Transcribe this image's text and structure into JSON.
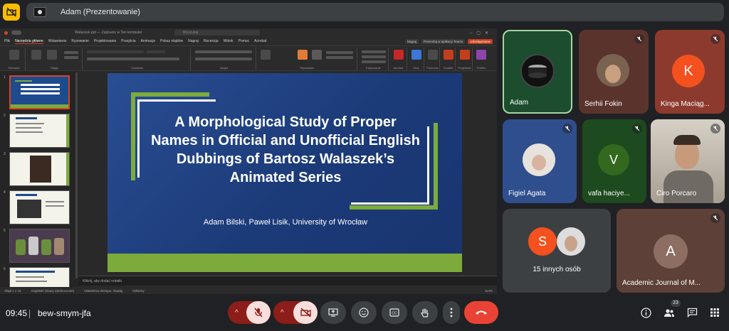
{
  "presenter_bar": {
    "title": "Adam (Prezentowanie)"
  },
  "powerpoint": {
    "doc_name": "Walaszek ppt — Zapisano w Ten komputer",
    "search_placeholder": "Wyszukaj",
    "menus": [
      "Plik",
      "Narzędzia główne",
      "Wstawianie",
      "Rysowanie",
      "Projektowanie",
      "Przejścia",
      "Animacje",
      "Pokaz slajdów",
      "Nagraj",
      "Recenzja",
      "Widok",
      "Pomoc",
      "Acrobat"
    ],
    "right_buttons": {
      "record": "Nagraj",
      "teams": "Prezentuj w aplikacji Teams",
      "share": "Udostępnianie"
    },
    "groups": [
      "Schowek",
      "Slajdy",
      "Czcionka",
      "Akapit",
      "Rysowanie",
      "Edytowanie",
      "Acrobat",
      "Głos",
      "Poufność",
      "Dodatki",
      "Projektant",
      "Prefiks"
    ],
    "notes_placeholder": "Kliknij, aby dodać notatki",
    "status": {
      "slide": "Slajd 1 z 16",
      "lang": "Angielski (Stany Zjednoczone)",
      "access": "Ułatwienia dostępu: zbadaj",
      "display": "Odsłony",
      "zoom": "114%"
    },
    "slide_numbers": [
      "1",
      "2",
      "3",
      "4",
      "5",
      "6"
    ]
  },
  "slide": {
    "title": "A Morphological Study of Proper Names in Official and Unofficial English Dubbings of Bartosz Walaszek’s Animated Series",
    "authors": "Adam Bilski, Paweł Lisik,  University of Wrocław"
  },
  "participants": [
    {
      "name": "Adam",
      "muted": false
    },
    {
      "name": "Serhii Fokin",
      "muted": true
    },
    {
      "name": "Kinga Maciąg...",
      "muted": true,
      "initial": "K",
      "color": "#f4511e"
    },
    {
      "name": "Figiel Agata",
      "muted": true
    },
    {
      "name": "vafa haciye...",
      "muted": true,
      "initial": "V",
      "color": "#33691e"
    },
    {
      "name": "Ciro Porcaro",
      "muted": true
    },
    {
      "name": "15 innych osób",
      "initial": "S",
      "color": "#f4511e"
    },
    {
      "name": "Academic Journal of M...",
      "muted": true,
      "initial": "A",
      "color": "#8d6e63"
    }
  ],
  "meeting": {
    "time": "09:45",
    "code": "bew-smym-jfa",
    "people_count": "23"
  },
  "colors": {
    "end_call": "#ea4335",
    "muted_red": "#f9dedc",
    "accent_green": "#7dab3b",
    "slide_blue": "#1f4283"
  }
}
